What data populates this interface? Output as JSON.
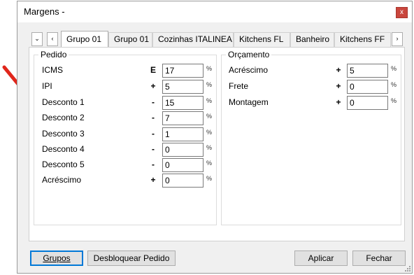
{
  "window": {
    "title": "Margens -",
    "close_label": "x"
  },
  "tabs": {
    "scroll_down": "⌄",
    "scroll_left": "‹",
    "scroll_right": "›",
    "items": [
      "Grupo 01",
      "Grupo 01",
      "Cozinhas ITALINEA",
      "Kitchens FL",
      "Banheiro",
      "Kitchens FF"
    ],
    "active_index": 0
  },
  "pedido": {
    "legend": "Pedido",
    "rows": [
      {
        "label": "ICMS",
        "op": "E",
        "value": "17",
        "unit": "%"
      },
      {
        "label": "IPI",
        "op": "+",
        "value": "5",
        "unit": "%"
      },
      {
        "label": "Desconto 1",
        "op": "-",
        "value": "15",
        "unit": "%"
      },
      {
        "label": "Desconto 2",
        "op": "-",
        "value": "7",
        "unit": "%"
      },
      {
        "label": "Desconto 3",
        "op": "-",
        "value": "1",
        "unit": "%"
      },
      {
        "label": "Desconto 4",
        "op": "-",
        "value": "0",
        "unit": "%"
      },
      {
        "label": "Desconto 5",
        "op": "-",
        "value": "0",
        "unit": "%"
      },
      {
        "label": "Acréscimo",
        "op": "+",
        "value": "0",
        "unit": "%"
      }
    ]
  },
  "orcamento": {
    "legend": "Orçamento",
    "rows": [
      {
        "label": "Acréscimo",
        "op": "+",
        "value": "5",
        "unit": "%"
      },
      {
        "label": "Frete",
        "op": "+",
        "value": "0",
        "unit": "%"
      },
      {
        "label": "Montagem",
        "op": "+",
        "value": "0",
        "unit": "%"
      }
    ]
  },
  "buttons": {
    "grupos": "Grupos",
    "desbloquear": "Desbloquear Pedido",
    "aplicar": "Aplicar",
    "fechar": "Fechar"
  },
  "colors": {
    "arrow": "#e0261b",
    "focus": "#0078d7",
    "close": "#c9463d"
  },
  "icons": {
    "annotation": "red-arrow-icon",
    "resize": "resize-grip-icon"
  }
}
